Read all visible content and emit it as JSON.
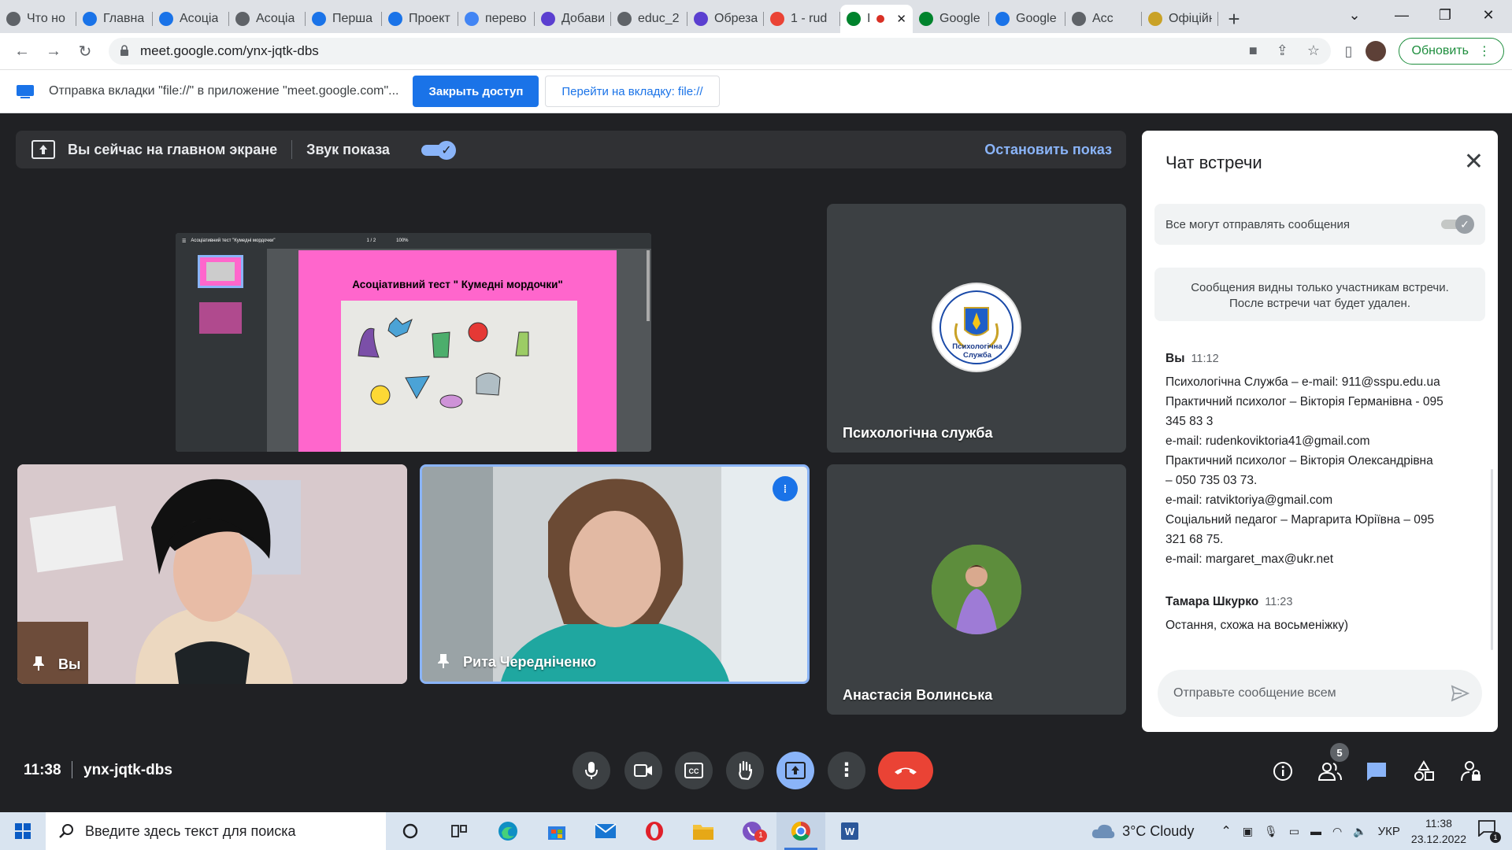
{
  "browser": {
    "tabs": [
      {
        "label": "Что но",
        "icon": "chrome-icon",
        "color": "#5f6368"
      },
      {
        "label": "Главна",
        "icon": "site-icon",
        "color": "#1a73e8"
      },
      {
        "label": "Асоціа",
        "icon": "site-icon",
        "color": "#1a73e8"
      },
      {
        "label": "Асоціа",
        "icon": "globe-icon",
        "color": "#5f6368"
      },
      {
        "label": "Перша",
        "icon": "site-icon",
        "color": "#1a73e8"
      },
      {
        "label": "Проект",
        "icon": "doc-icon",
        "color": "#1a73e8"
      },
      {
        "label": "перево",
        "icon": "google-icon",
        "color": "#4285f4"
      },
      {
        "label": "Добави",
        "icon": "shield-icon",
        "color": "#5b3fd0"
      },
      {
        "label": "educ_2",
        "icon": "globe-icon",
        "color": "#5f6368"
      },
      {
        "label": "Обреза",
        "icon": "shield-icon",
        "color": "#5b3fd0"
      },
      {
        "label": "1 - rud",
        "icon": "gmail-icon",
        "color": "#ea4335"
      },
      {
        "label": "I",
        "icon": "meet-icon",
        "color": "#00832d",
        "active": true
      },
      {
        "label": "Google",
        "icon": "meet-icon",
        "color": "#00832d"
      },
      {
        "label": "Google",
        "icon": "calendar-icon",
        "color": "#1a73e8"
      },
      {
        "label": "Acc",
        "icon": "globe-icon",
        "color": "#5f6368"
      },
      {
        "label": "Офіційні",
        "icon": "coat-icon",
        "color": "#c9a227"
      }
    ],
    "url": "meet.google.com/ynx-jqtk-dbs",
    "update_label": "Обновить"
  },
  "infobar": {
    "message": "Отправка вкладки \"file://\" в приложение \"meet.google.com\"...",
    "close_access": "Закрыть доступ",
    "goto_tab": "Перейти на вкладку: file://"
  },
  "meet": {
    "present_text": "Вы сейчас на главном экране",
    "sound_label": "Звук показа",
    "stop_label": "Остановить показ",
    "slide_title": "Асоціативний тест \" Кумедні мордочки\"",
    "viewer_title": "Асоціативний тест \"Кумедні мордочки\"",
    "viewer_page": "1 / 2",
    "viewer_zoom": "100%",
    "tiles": {
      "service": "Психологічна служба",
      "you": "Вы",
      "rita": "Рита Чередніченко",
      "anastasia": "Анастасія Волинська"
    },
    "logo_text": "Психологічна Служба",
    "clock": "11:38",
    "meeting_code": "ynx-jqtk-dbs",
    "participants_count": "5"
  },
  "chat": {
    "title": "Чат встречи",
    "permission": "Все могут отправлять сообщения",
    "notice_line1": "Сообщения видны только участникам встречи.",
    "notice_line2": "После встречи чат будет удален.",
    "messages": [
      {
        "sender": "Вы",
        "time": "11:12",
        "lines": [
          "Психологічна Служба – e-mail: 911@sspu.edu.ua",
          "Практичний психолог – Вікторія Германівна - 095",
          "345 83 3",
          "e-mail: rudenkoviktoria41@gmail.com",
          "Практичний психолог – Вікторія Олександрівна",
          "– 050 735 03 73.",
          "e-mail: ratviktoriya@gmail.com",
          "Соціальний педагог – Маргарита Юріївна – 095",
          "321 68 75.",
          "e-mail: margaret_max@ukr.net"
        ]
      },
      {
        "sender": "Тамара Шкурко",
        "time": "11:23",
        "lines": [
          "Остання, схожа на восьменіжку)"
        ]
      }
    ],
    "input_placeholder": "Отправьте сообщение всем"
  },
  "taskbar": {
    "search_placeholder": "Введите здесь текст для поиска",
    "weather": "3°C  Cloudy",
    "lang": "УКР",
    "time": "11:38",
    "date": "23.12.2022",
    "notif_count": "1",
    "viber_badge": "1"
  },
  "colors": {
    "meet_bg": "#202124",
    "accent_blue": "#8ab4f8",
    "end_call_red": "#ea4335",
    "slide_pink": "#ff66cc"
  }
}
